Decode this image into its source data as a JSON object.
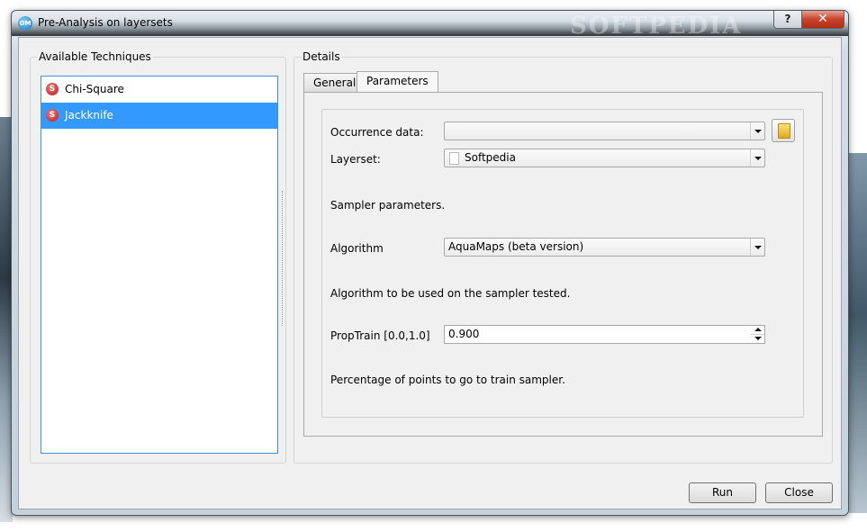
{
  "window": {
    "title": "Pre-Analysis on layersets",
    "app_icon_text": "OM",
    "watermark": "SOFTPEDIA",
    "help_label": "?",
    "close_label": "✕"
  },
  "techniques": {
    "title": "Available Techniques",
    "items": [
      {
        "label": "Chi-Square",
        "icon": "S",
        "selected": false
      },
      {
        "label": "Jackknife",
        "icon": "S",
        "selected": true
      }
    ]
  },
  "details": {
    "title": "Details",
    "tabs": [
      {
        "label": "General",
        "active": false
      },
      {
        "label": "Parameters",
        "active": true
      }
    ],
    "occurrence": {
      "label": "Occurrence data:",
      "value": ""
    },
    "layerset": {
      "label": "Layerset:",
      "value": "Softpedia"
    },
    "sampler_text": "Sampler parameters.",
    "algorithm": {
      "label": "Algorithm",
      "value": "AquaMaps (beta version)",
      "help": "Algorithm to be used on the sampler tested."
    },
    "proptrain": {
      "label": "PropTrain [0.0,1.0]",
      "value": "0.900",
      "help": "Percentage of points to go to train sampler."
    }
  },
  "buttons": {
    "run": "Run",
    "close": "Close"
  }
}
